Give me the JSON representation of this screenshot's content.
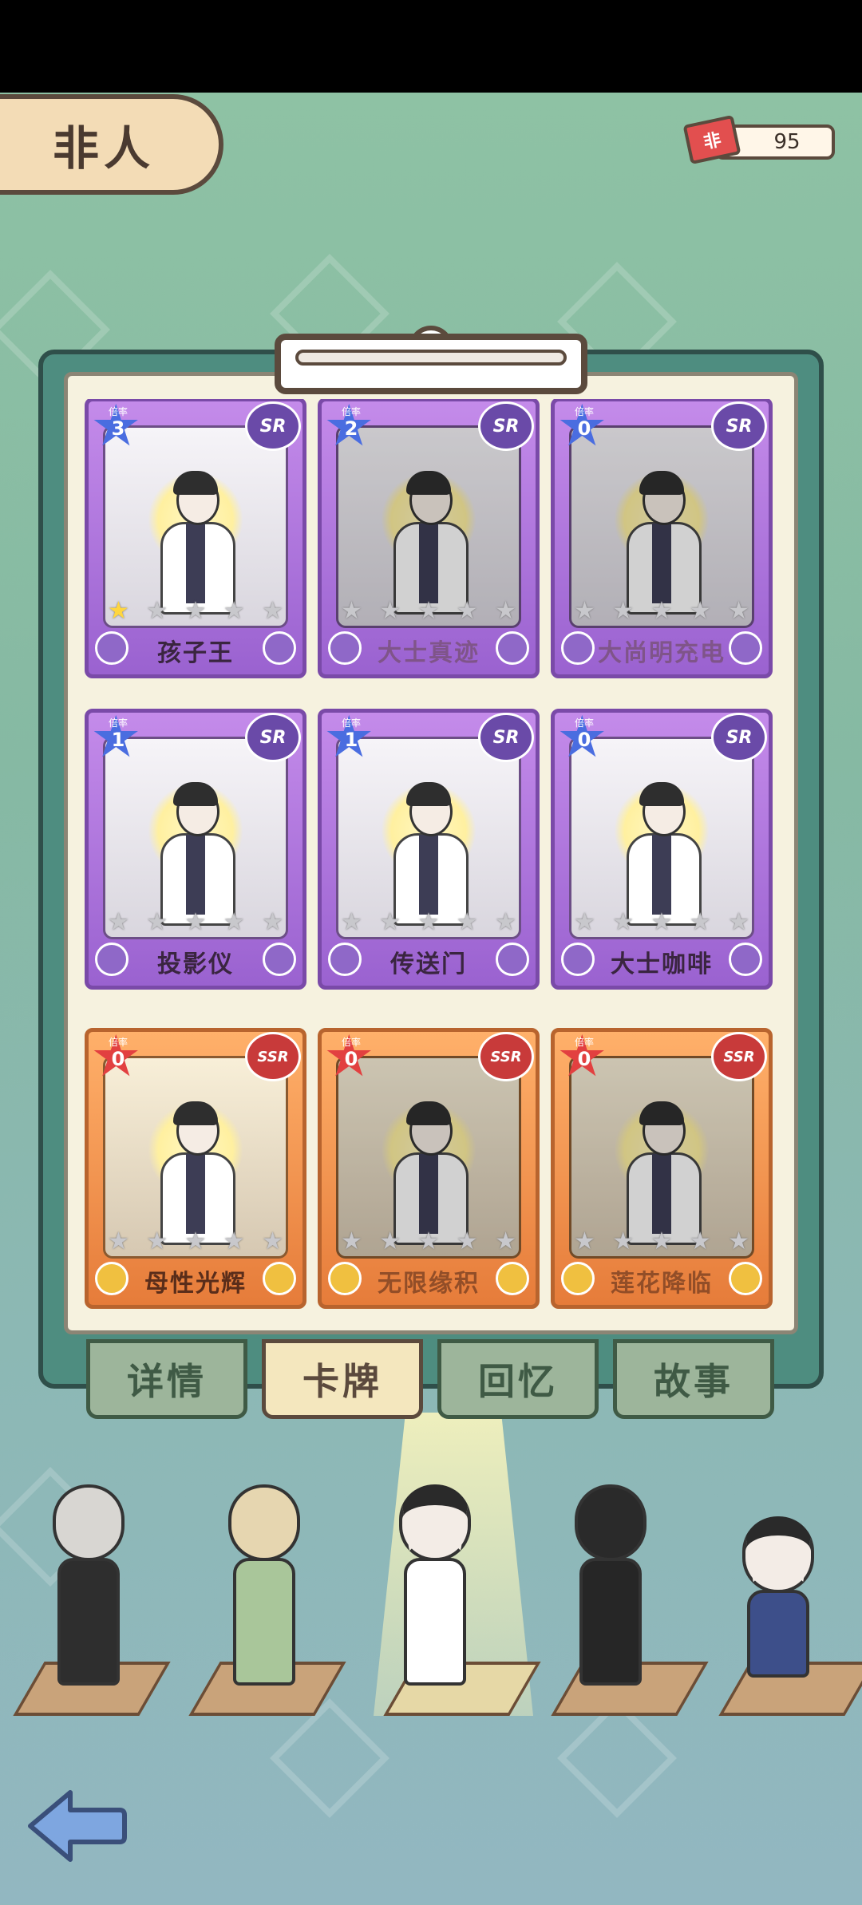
{
  "header": {
    "title": "非人"
  },
  "currency": {
    "icon_label": "非",
    "amount": "95"
  },
  "cards": [
    {
      "name": "孩子王",
      "rarity": "SR",
      "multiplier_label": "倍率",
      "multiplier": "3",
      "stars_on": 1,
      "dim": false
    },
    {
      "name": "大士真迹",
      "rarity": "SR",
      "multiplier_label": "倍率",
      "multiplier": "2",
      "stars_on": 0,
      "dim": true
    },
    {
      "name": "大尚明充电",
      "rarity": "SR",
      "multiplier_label": "倍率",
      "multiplier": "0",
      "stars_on": 0,
      "dim": true
    },
    {
      "name": "投影仪",
      "rarity": "SR",
      "multiplier_label": "倍率",
      "multiplier": "1",
      "stars_on": 0,
      "dim": false
    },
    {
      "name": "传送门",
      "rarity": "SR",
      "multiplier_label": "倍率",
      "multiplier": "1",
      "stars_on": 0,
      "dim": false
    },
    {
      "name": "大士咖啡",
      "rarity": "SR",
      "multiplier_label": "倍率",
      "multiplier": "0",
      "stars_on": 0,
      "dim": false
    },
    {
      "name": "母性光辉",
      "rarity": "SSR",
      "multiplier_label": "倍率",
      "multiplier": "0",
      "stars_on": 0,
      "dim": false
    },
    {
      "name": "无限缘积",
      "rarity": "SSR",
      "multiplier_label": "倍率",
      "multiplier": "0",
      "stars_on": 0,
      "dim": true
    },
    {
      "name": "莲花降临",
      "rarity": "SSR",
      "multiplier_label": "倍率",
      "multiplier": "0",
      "stars_on": 0,
      "dim": true
    }
  ],
  "tabs": [
    {
      "label": "详情",
      "active": false
    },
    {
      "label": "卡牌",
      "active": true
    },
    {
      "label": "回忆",
      "active": false
    },
    {
      "label": "故事",
      "active": false
    }
  ],
  "characters": [
    "deer-beast-character",
    "rabbit-girl-character",
    "halo-man-character",
    "shadow-man-character",
    "boy-character"
  ],
  "colors": {
    "sr_frame": "#9a62d0",
    "ssr_frame": "#e67c3a",
    "tab_active": "#f4e7be"
  }
}
